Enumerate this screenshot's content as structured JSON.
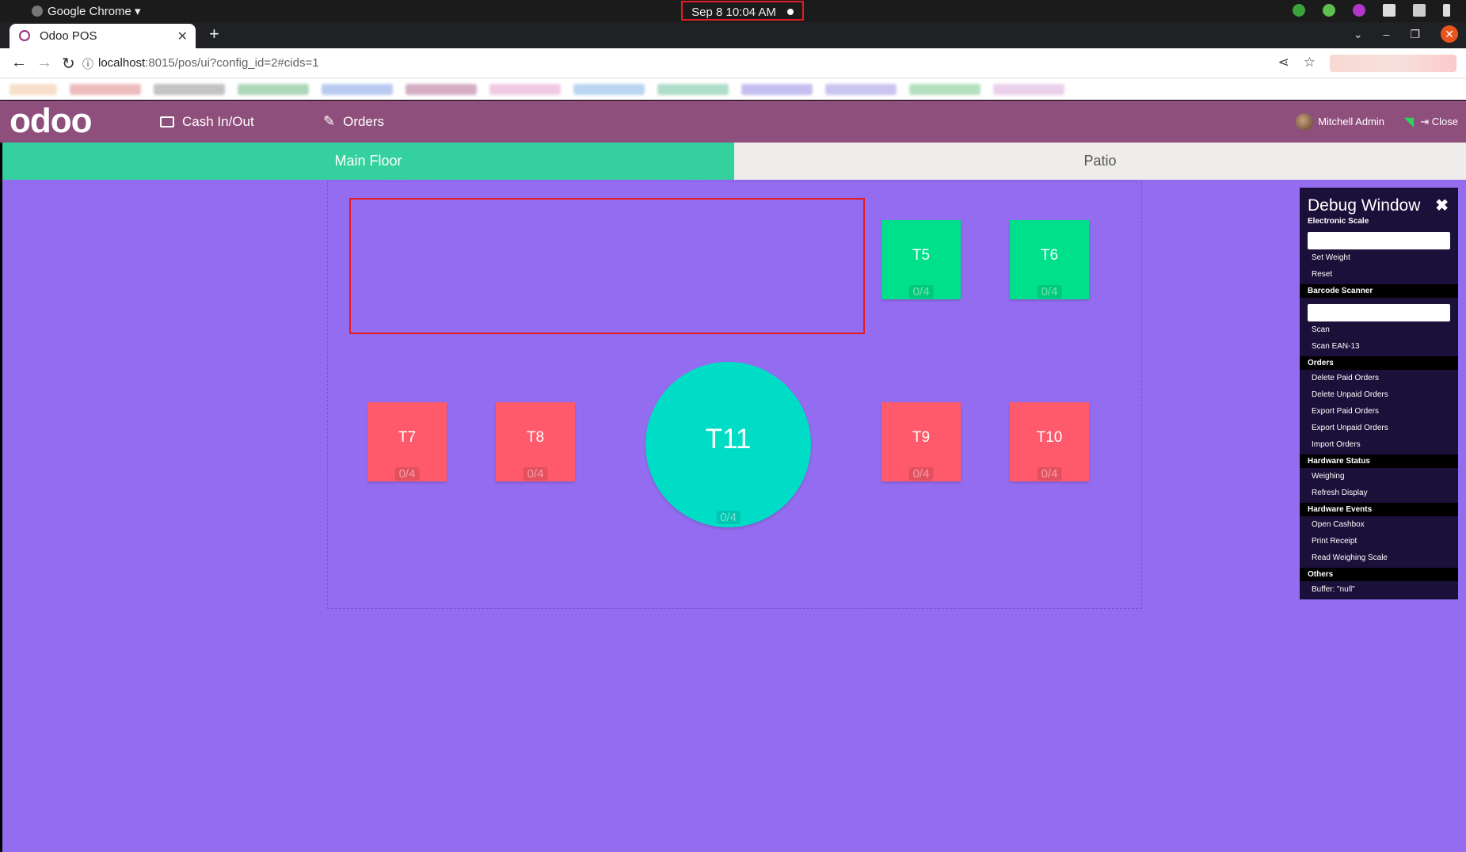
{
  "os_bar": {
    "app_name": "Google Chrome",
    "clock": "Sep 8  10:04 AM"
  },
  "browser": {
    "tab_title": "Odoo POS",
    "new_tab": "+",
    "url_host": "localhost",
    "url_rest": ":8015/pos/ui?config_id=2#cids=1"
  },
  "header": {
    "logo": "odoo",
    "cash_label": "Cash In/Out",
    "orders_label": "Orders",
    "user_name": "Mitchell Admin",
    "close_label": "Close"
  },
  "floor_tabs": {
    "main": "Main Floor",
    "patio": "Patio"
  },
  "tables": [
    {
      "name": "T5",
      "seats": "0/4",
      "color": "#00e08a"
    },
    {
      "name": "T6",
      "seats": "0/4",
      "color": "#00e08a"
    },
    {
      "name": "T7",
      "seats": "0/4",
      "color": "#fe5a6b"
    },
    {
      "name": "T8",
      "seats": "0/4",
      "color": "#fe5a6b"
    },
    {
      "name": "T11",
      "seats": "0/4",
      "color": "#00ddc6"
    },
    {
      "name": "T9",
      "seats": "0/4",
      "color": "#fe5a6b"
    },
    {
      "name": "T10",
      "seats": "0/4",
      "color": "#fe5a6b"
    }
  ],
  "debug": {
    "title": "Debug Window",
    "electronic_scale": "Electronic Scale",
    "set_weight": "Set Weight",
    "reset": "Reset",
    "barcode_scanner": "Barcode Scanner",
    "scan": "Scan",
    "scan_ean": "Scan EAN-13",
    "orders": "Orders",
    "delete_paid": "Delete Paid Orders",
    "delete_unpaid": "Delete Unpaid Orders",
    "export_paid": "Export Paid Orders",
    "export_unpaid": "Export Unpaid Orders",
    "import_orders": "Import Orders",
    "hardware_status": "Hardware Status",
    "weighing": "Weighing",
    "refresh_display": "Refresh Display",
    "hardware_events": "Hardware Events",
    "open_cashbox": "Open Cashbox",
    "print_receipt": "Print Receipt",
    "read_weighing": "Read Weighing Scale",
    "others": "Others",
    "buffer": "Buffer: \"null\""
  },
  "colors": {
    "header": "#8f4f7c",
    "floor_bg": "#946cf0",
    "active_tab": "#34d19e"
  }
}
